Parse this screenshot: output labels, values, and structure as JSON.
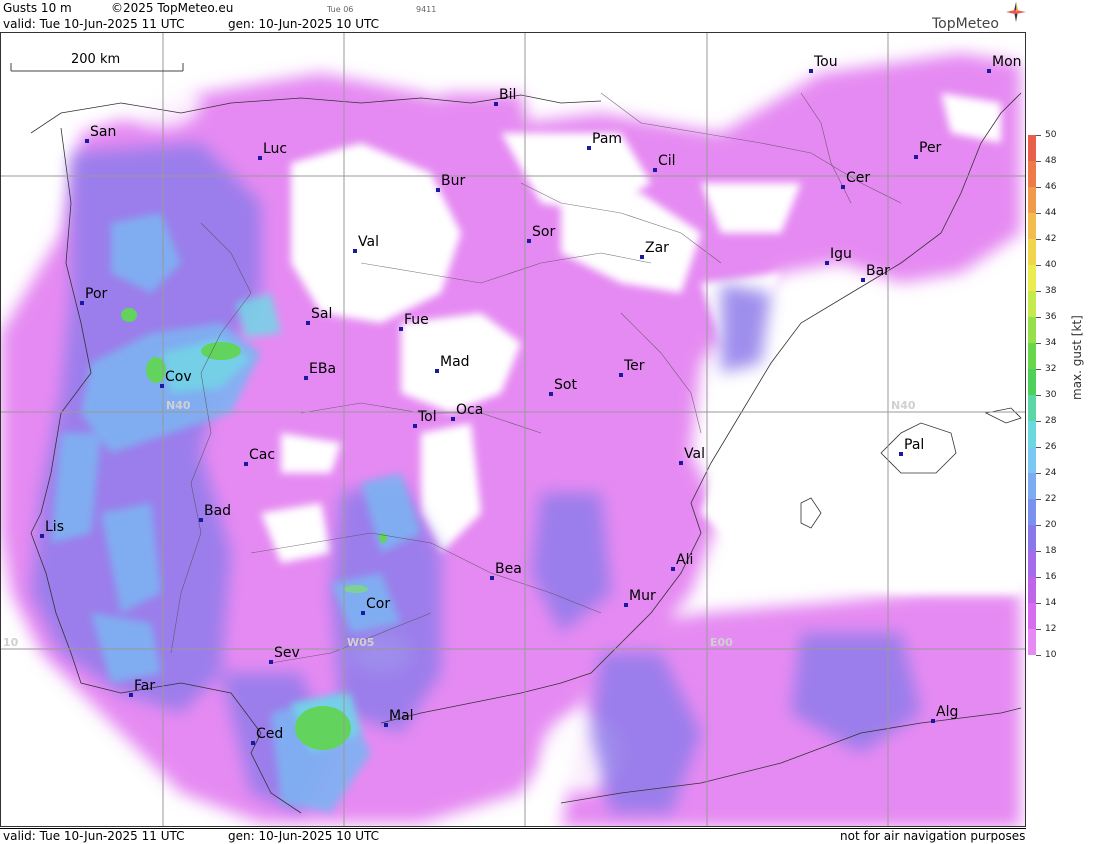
{
  "header": {
    "product": "Gusts 10 m",
    "copyright": "©2025 TopMeteo.eu",
    "valid_text": "valid:  Tue  10-Jun-2025  11 UTC",
    "gen_text": "gen: 10-Jun-2025 10 UTC",
    "run_label": "Tue 06",
    "code": "9411",
    "logo": "TopMeteo"
  },
  "scale_bar": {
    "label": "200 km"
  },
  "grid_labels": {
    "n40_left": "N40",
    "n40_right": "N40",
    "w05": "W05",
    "e00": "E00",
    "w10": "10"
  },
  "cities": [
    {
      "name": "San"
    },
    {
      "name": "Luc"
    },
    {
      "name": "Bil"
    },
    {
      "name": "Tou"
    },
    {
      "name": "Mon"
    },
    {
      "name": "Pam"
    },
    {
      "name": "Cil"
    },
    {
      "name": "Per"
    },
    {
      "name": "Cer"
    },
    {
      "name": "Bur"
    },
    {
      "name": "Val"
    },
    {
      "name": "Sor"
    },
    {
      "name": "Zar"
    },
    {
      "name": "Igu"
    },
    {
      "name": "Bar"
    },
    {
      "name": "Por"
    },
    {
      "name": "Sal"
    },
    {
      "name": "Fue"
    },
    {
      "name": "Mad"
    },
    {
      "name": "Cov"
    },
    {
      "name": "EBa"
    },
    {
      "name": "Sot"
    },
    {
      "name": "Ter"
    },
    {
      "name": "Tol"
    },
    {
      "name": "Oca"
    },
    {
      "name": "Cac"
    },
    {
      "name": "Val"
    },
    {
      "name": "Pal"
    },
    {
      "name": "Bad"
    },
    {
      "name": "Lis"
    },
    {
      "name": "Bea"
    },
    {
      "name": "Ali"
    },
    {
      "name": "Mur"
    },
    {
      "name": "Cor"
    },
    {
      "name": "Sev"
    },
    {
      "name": "Far"
    },
    {
      "name": "Alg"
    },
    {
      "name": "Mal"
    },
    {
      "name": "Ced"
    }
  ],
  "legend": {
    "title": "max. gust [kt]",
    "levels": [
      "50",
      "48",
      "46",
      "44",
      "42",
      "40",
      "38",
      "36",
      "34",
      "32",
      "30",
      "28",
      "26",
      "24",
      "22",
      "20",
      "18",
      "16",
      "14",
      "12",
      "10"
    ],
    "colors": [
      "#e8604c",
      "#ee7a4a",
      "#f19a4c",
      "#f4bb4e",
      "#f2d54e",
      "#eceb50",
      "#c4ea4e",
      "#96e04a",
      "#6ad64c",
      "#4fd05a",
      "#5ad6a8",
      "#6cd8e0",
      "#7cc8f4",
      "#7cabf2",
      "#7a92ee",
      "#8878ea",
      "#a46cea",
      "#c064ea",
      "#d86cf0",
      "#e88af4"
    ]
  },
  "footer": {
    "valid_text": "valid:  Tue  10-Jun-2025  11 UTC",
    "gen_text": "gen: 10-Jun-2025 10 UTC",
    "disclaimer": "not for air navigation purposes"
  }
}
